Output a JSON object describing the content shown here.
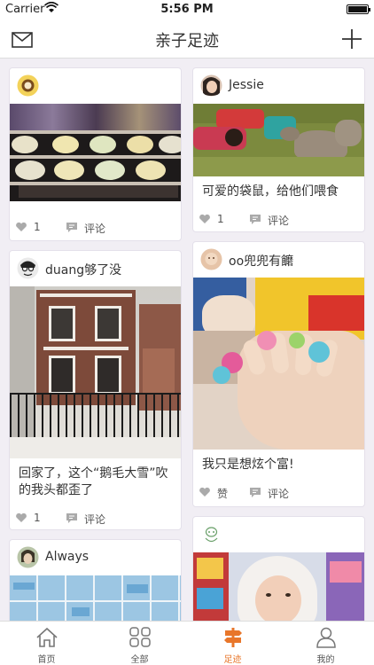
{
  "status": {
    "carrier": "Carrier",
    "time": "5:56 PM"
  },
  "header": {
    "title": "亲子足迹"
  },
  "posts": [
    {
      "user": "",
      "caption": "",
      "likes": "1",
      "comment_label": "评论"
    },
    {
      "user": "Jessie",
      "caption": "可爱的袋鼠，给他们喂食",
      "likes": "1",
      "comment_label": "评论"
    },
    {
      "user": "duang够了没",
      "caption": "回家了，这个“鹅毛大雪”吹的我头都歪了",
      "likes": "1",
      "comment_label": "评论"
    },
    {
      "user": "oo兜兜有饝",
      "caption": "我只是想炫个富!",
      "likes": "赞",
      "comment_label": "评论"
    },
    {
      "user": "Always",
      "caption": "",
      "likes": "",
      "comment_label": ""
    },
    {
      "user": "",
      "caption": "",
      "likes": "",
      "comment_label": ""
    }
  ],
  "tabs": [
    {
      "label": "首页",
      "icon": "home-icon"
    },
    {
      "label": "全部",
      "icon": "grid-icon"
    },
    {
      "label": "足迹",
      "icon": "signpost-icon"
    },
    {
      "label": "我的",
      "icon": "person-icon"
    }
  ],
  "colors": {
    "accent": "#e8762a",
    "background": "#f1eef4"
  }
}
